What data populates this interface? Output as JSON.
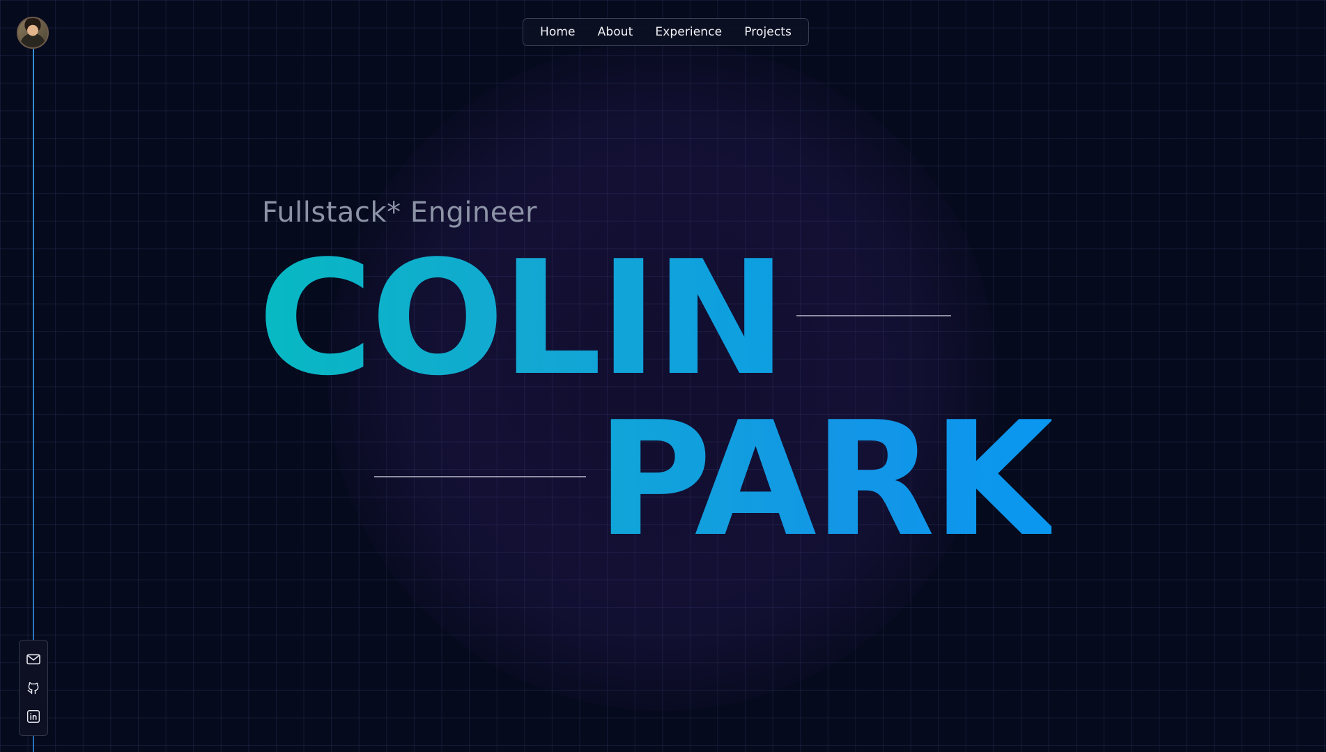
{
  "nav": {
    "items": [
      {
        "label": "Home"
      },
      {
        "label": "About"
      },
      {
        "label": "Experience"
      },
      {
        "label": "Projects"
      }
    ]
  },
  "hero": {
    "subtitle": "Fullstack* Engineer",
    "first_name": "COLIN",
    "last_name": "PARK"
  },
  "social": {
    "icons": [
      "mail-icon",
      "github-icon",
      "linkedin-icon"
    ]
  },
  "colors": {
    "background": "#060a1d",
    "accent_start": "#08b7c6",
    "accent_end": "#0a97f0",
    "side_line": "#3aa8f5"
  }
}
